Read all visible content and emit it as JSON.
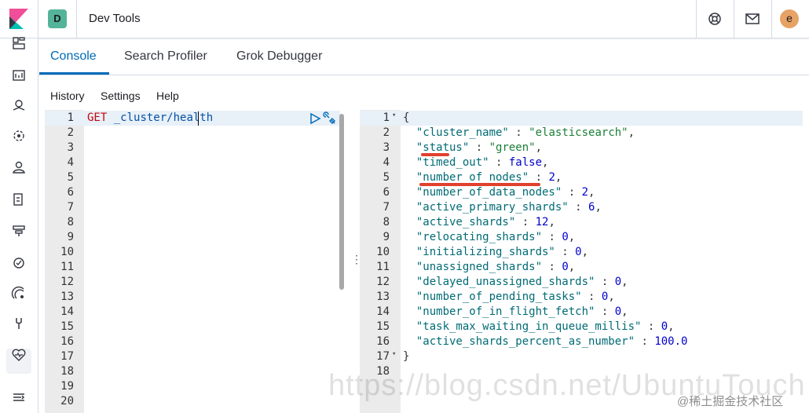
{
  "header": {
    "space_initial": "D",
    "app_title": "Dev Tools",
    "user_initial": "e",
    "colors": {
      "accent": "#006bb8",
      "space_badge": "#54b399",
      "avatar": "#e7a265"
    }
  },
  "tabs": [
    {
      "label": "Console",
      "active": true
    },
    {
      "label": "Search Profiler",
      "active": false
    },
    {
      "label": "Grok Debugger",
      "active": false
    }
  ],
  "menu": {
    "history": "History",
    "settings": "Settings",
    "help": "Help"
  },
  "request": {
    "line_numbers": [
      "1",
      "2",
      "3",
      "4",
      "5",
      "6",
      "7",
      "8",
      "9",
      "10",
      "11",
      "12",
      "13",
      "14",
      "15",
      "16",
      "17",
      "18",
      "19",
      "20"
    ],
    "method": "GET",
    "path": "_cluster/health"
  },
  "response": {
    "line_numbers": [
      "1",
      "2",
      "3",
      "4",
      "5",
      "6",
      "7",
      "8",
      "9",
      "10",
      "11",
      "12",
      "13",
      "14",
      "15",
      "16",
      "17",
      "18"
    ],
    "open_brace": "{",
    "close_brace": "}",
    "fields": [
      {
        "key": "\"cluster_name\"",
        "value": "\"elasticsearch\"",
        "type": "string"
      },
      {
        "key": "\"status\"",
        "value": "\"green\"",
        "type": "string"
      },
      {
        "key": "\"timed_out\"",
        "value": "false",
        "type": "bool"
      },
      {
        "key": "\"number_of_nodes\"",
        "value": "2",
        "type": "number"
      },
      {
        "key": "\"number_of_data_nodes\"",
        "value": "2",
        "type": "number"
      },
      {
        "key": "\"active_primary_shards\"",
        "value": "6",
        "type": "number"
      },
      {
        "key": "\"active_shards\"",
        "value": "12",
        "type": "number"
      },
      {
        "key": "\"relocating_shards\"",
        "value": "0",
        "type": "number"
      },
      {
        "key": "\"initializing_shards\"",
        "value": "0",
        "type": "number"
      },
      {
        "key": "\"unassigned_shards\"",
        "value": "0",
        "type": "number"
      },
      {
        "key": "\"delayed_unassigned_shards\"",
        "value": "0",
        "type": "number"
      },
      {
        "key": "\"number_of_pending_tasks\"",
        "value": "0",
        "type": "number"
      },
      {
        "key": "\"number_of_in_flight_fetch\"",
        "value": "0",
        "type": "number"
      },
      {
        "key": "\"task_max_waiting_in_queue_millis\"",
        "value": "0",
        "type": "number"
      },
      {
        "key": "\"active_shards_percent_as_number\"",
        "value": "100.0",
        "type": "number"
      }
    ]
  },
  "watermark": {
    "url": "https://blog.csdn.net/UbuntuTouch",
    "site": "@稀土掘金技术社区"
  },
  "icons": [
    "kibana-logo-icon",
    "help-icon",
    "mail-icon",
    "dashboard-icon",
    "canvas-icon",
    "maps-icon",
    "ml-icon",
    "users-icon",
    "logs-icon",
    "apm-icon",
    "uptime-icon",
    "siem-icon",
    "dev-tools-icon",
    "monitoring-icon",
    "collapse-nav-icon",
    "play-icon",
    "wrench-icon"
  ]
}
